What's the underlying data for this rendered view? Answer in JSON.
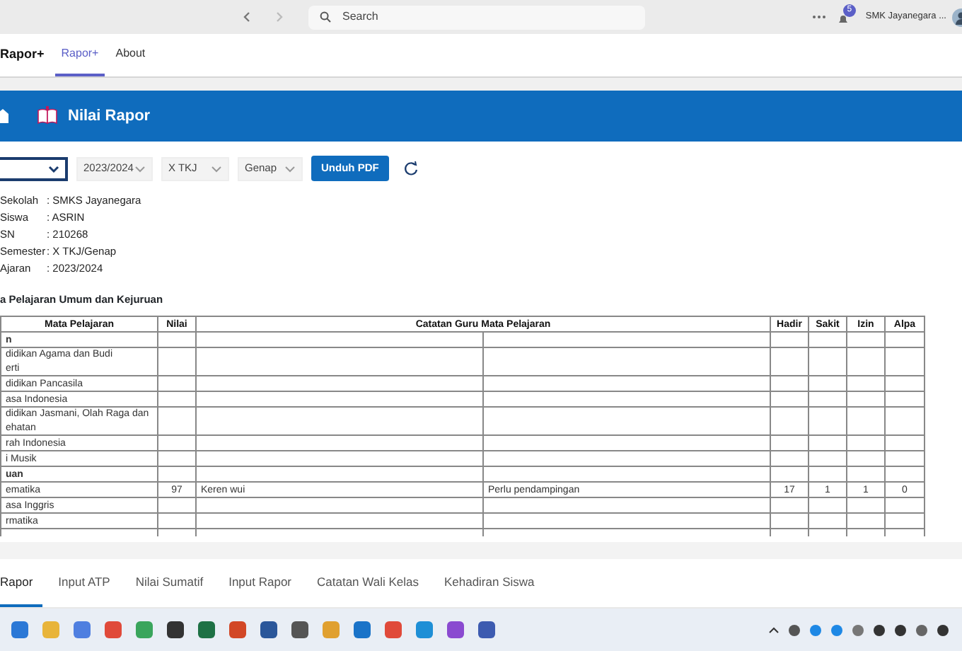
{
  "top_bar": {
    "search": {
      "placeholder": "Search"
    },
    "notification_count": "5",
    "account": "SMK Jayanegara ..."
  },
  "app_bar": {
    "app_name": "Rapor+",
    "tabs": [
      {
        "label": "Rapor+",
        "selected": true
      },
      {
        "label": "About",
        "selected": false
      }
    ]
  },
  "header": {
    "title": "Nilai Rapor"
  },
  "filters": [
    {
      "kind": "select",
      "focused": true
    },
    {
      "kind": "select",
      "value": "2023/2024",
      "focused": false
    },
    {
      "kind": "select",
      "value": "X TKJ",
      "focused": false
    },
    {
      "kind": "select",
      "value": "Genap",
      "focused": false
    },
    {
      "kind": "button",
      "label": "Unduh PDF"
    },
    {
      "kind": "refresh"
    }
  ],
  "info": [
    {
      "label": "Sekolah",
      "value": ": SMKS Jayanegara"
    },
    {
      "label": "Siswa",
      "value": ": ASRIN"
    },
    {
      "label": "SN",
      "value": ": 210268"
    },
    {
      "label": "Semester",
      "value": ": X TKJ/Genap"
    },
    {
      "label": "Ajaran",
      "value": ": 2023/2024"
    }
  ],
  "section_title": "a Pelajaran Umum dan Kejuruan",
  "table": {
    "columns": [
      "Mata Pelajaran",
      "Nilai",
      "Catatan Guru Mata Pelajaran",
      "Hadir",
      "Sakit",
      "Izin",
      "Alpa"
    ],
    "rows": [
      {
        "kind": "group",
        "subject": "n"
      },
      {
        "kind": "subject",
        "subject": "didikan Agama dan Budi\nerti"
      },
      {
        "kind": "subject",
        "subject": "didikan Pancasila"
      },
      {
        "kind": "subject",
        "subject": "asa Indonesia"
      },
      {
        "kind": "subject",
        "subject": "didikan Jasmani, Olah Raga dan\nehatan"
      },
      {
        "kind": "subject",
        "subject": "rah Indonesia"
      },
      {
        "kind": "subject",
        "subject": "i Musik"
      },
      {
        "kind": "group",
        "subject": "uan"
      },
      {
        "kind": "subject",
        "subject": "ematika",
        "nilai": "97",
        "catatan_1": "Keren wui",
        "catatan_2": "Perlu pendampingan",
        "hadir": "17",
        "sakit": "1",
        "izin": "1",
        "alpa": "0"
      },
      {
        "kind": "subject",
        "subject": "asa Inggris"
      },
      {
        "kind": "subject",
        "subject": "rmatika"
      },
      {
        "kind": "cut"
      }
    ]
  },
  "bottom_tabs": [
    {
      "label": "Rapor",
      "selected": true
    },
    {
      "label": "Input ATP",
      "selected": false
    },
    {
      "label": "Nilai Sumatif",
      "selected": false
    },
    {
      "label": "Input Rapor",
      "selected": false
    },
    {
      "label": "Catatan Wali Kelas",
      "selected": false
    },
    {
      "label": "Kehadiran Siswa",
      "selected": false
    }
  ]
}
